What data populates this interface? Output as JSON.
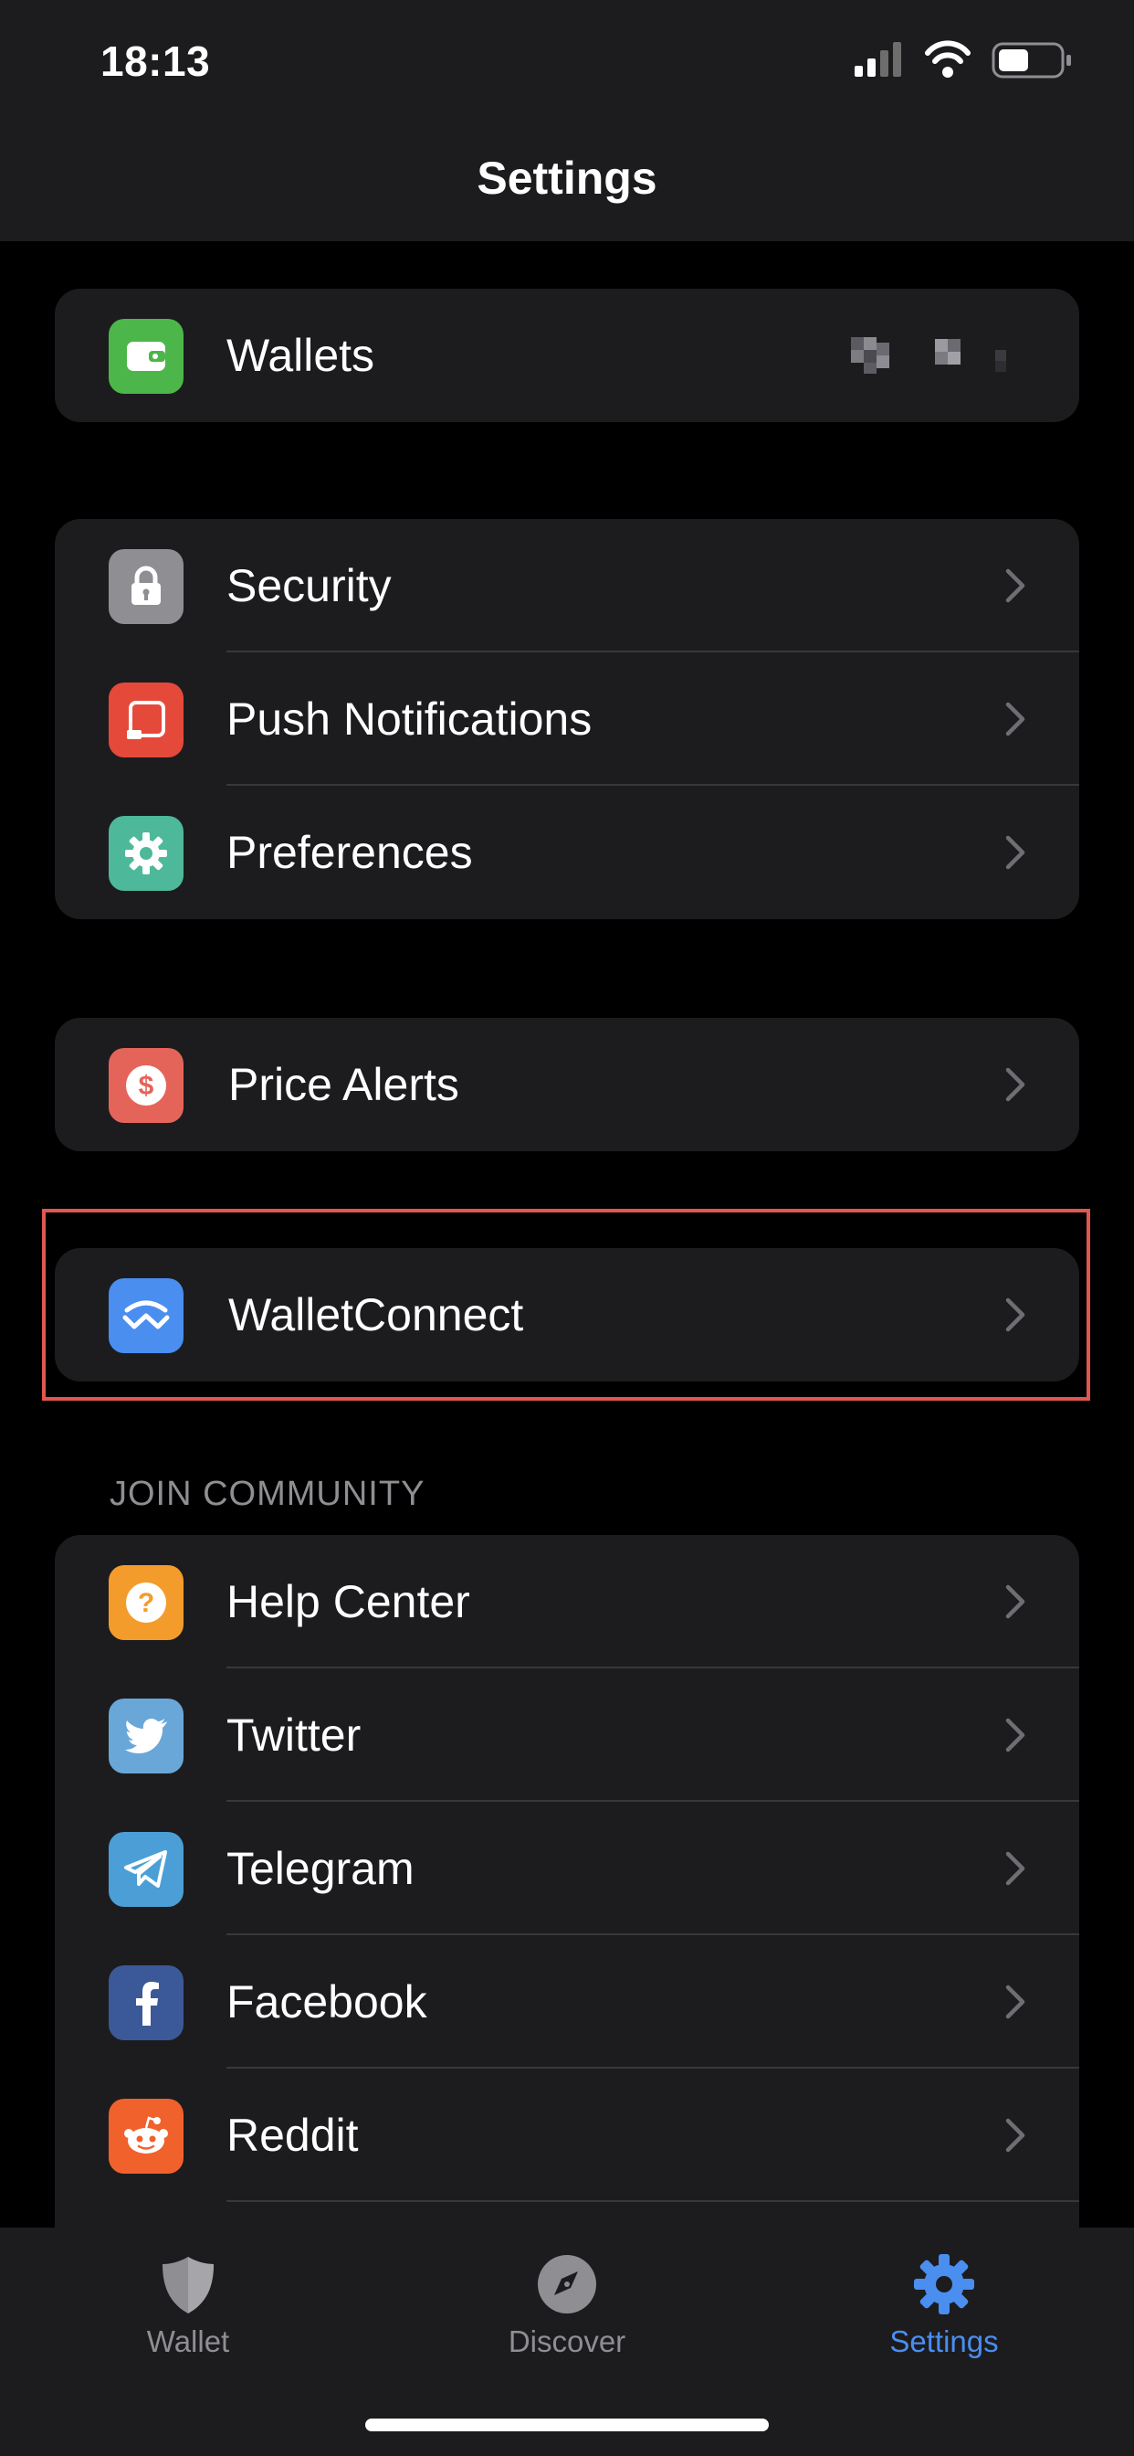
{
  "status_bar": {
    "time": "18:13"
  },
  "nav": {
    "title": "Settings"
  },
  "groups": {
    "wallets": {
      "label": "Wallets",
      "color": "#4cb64a"
    },
    "security": {
      "label": "Security",
      "color": "#8e8e93"
    },
    "push": {
      "label": "Push Notifications",
      "color": "#e5493a"
    },
    "preferences": {
      "label": "Preferences",
      "color": "#4db89a"
    },
    "price_alerts": {
      "label": "Price Alerts",
      "color": "#e5645a"
    },
    "walletconnect": {
      "label": "WalletConnect",
      "color": "#4a8ef0"
    }
  },
  "community": {
    "header": "JOIN COMMUNITY",
    "items": [
      {
        "label": "Help Center",
        "icon": "question-icon",
        "color": "#f39c2c"
      },
      {
        "label": "Twitter",
        "icon": "twitter-icon",
        "color": "#6aa7d9"
      },
      {
        "label": "Telegram",
        "icon": "telegram-icon",
        "color": "#4b9fd6"
      },
      {
        "label": "Facebook",
        "icon": "facebook-icon",
        "color": "#3b5998"
      },
      {
        "label": "Reddit",
        "icon": "reddit-icon",
        "color": "#f0612c"
      }
    ]
  },
  "tabbar": {
    "tabs": [
      {
        "label": "Wallet",
        "icon": "shield-icon"
      },
      {
        "label": "Discover",
        "icon": "compass-icon"
      },
      {
        "label": "Settings",
        "icon": "gear-icon",
        "active": true
      }
    ],
    "active_color": "#4a8ef0",
    "inactive_color": "#8e8e93"
  }
}
